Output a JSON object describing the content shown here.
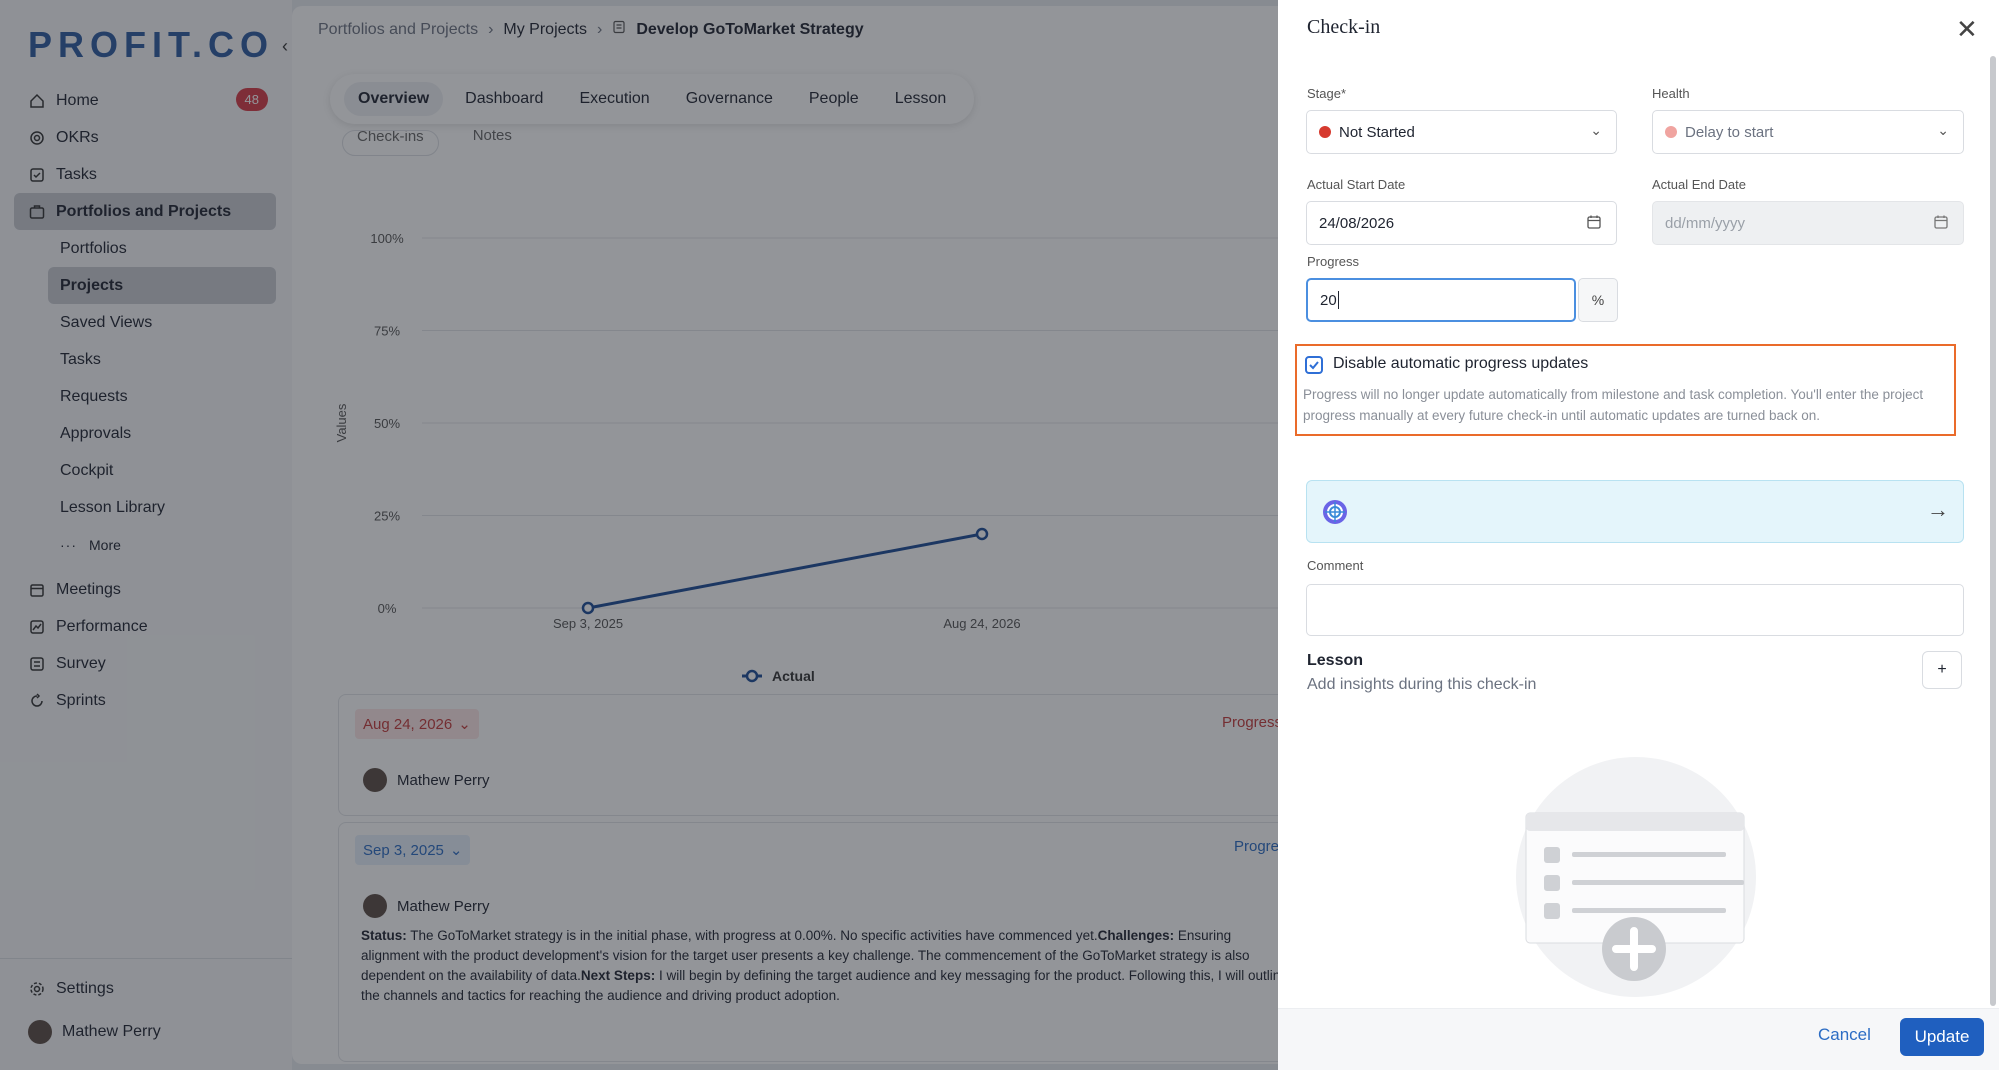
{
  "sidebar": {
    "logo": "PROFIT.CO",
    "collapse_icon": "‹",
    "items": [
      {
        "label": "Home",
        "icon": "home-icon",
        "badge": "48"
      },
      {
        "label": "OKRs",
        "icon": "target-icon"
      },
      {
        "label": "Tasks",
        "icon": "task-icon"
      },
      {
        "label": "Portfolios and Projects",
        "icon": "briefcase-icon",
        "active": true
      }
    ],
    "sub_items": [
      "Portfolios",
      "Projects",
      "Saved Views",
      "Tasks",
      "Requests",
      "Approvals",
      "Cockpit",
      "Lesson Library"
    ],
    "more_label": "More",
    "items2": [
      {
        "label": "Meetings",
        "icon": "calendar-icon"
      },
      {
        "label": "Performance",
        "icon": "performance-icon"
      },
      {
        "label": "Survey",
        "icon": "survey-icon"
      },
      {
        "label": "Sprints",
        "icon": "sprint-icon"
      }
    ],
    "settings_label": "Settings",
    "user_name": "Mathew Perry"
  },
  "main": {
    "breadcrumb": [
      "Portfolios and Projects",
      "My Projects",
      "Develop GoToMarket Strategy"
    ],
    "tabs": [
      "Overview",
      "Dashboard",
      "Execution",
      "Governance",
      "People",
      "Lesson"
    ],
    "subtabs": [
      "Check-ins",
      "Notes"
    ],
    "entries": [
      {
        "date": "Aug 24, 2026",
        "progress_label": "Progress",
        "user": "Mathew Perry"
      },
      {
        "date": "Sep 3, 2025",
        "progress_label": "Progre",
        "user": "Mathew Perry",
        "status_label": "Status:",
        "status_text": " The GoToMarket strategy is in the initial phase, with progress at 0.00%. No specific activities have commenced yet.",
        "challenges_label": "Challenges:",
        "challenges_text": " Ensuring alignment with the product development's vision for the target user presents a key challenge. The commencement of the GoToMarket strategy is also dependent on the availability of data.",
        "next_label": "Next Steps:",
        "next_text": " I will begin by defining the target audience and key messaging for the product. Following this, I will outline the channels and tactics for reaching the audience and driving product adoption."
      }
    ]
  },
  "chart_data": {
    "type": "line",
    "x": [
      "Sep 3, 2025",
      "Aug 24, 2026"
    ],
    "series": [
      {
        "name": "Actual",
        "values": [
          0,
          20
        ]
      }
    ],
    "ylabel": "Values",
    "yticks": [
      "100%",
      "75%",
      "50%",
      "25%",
      "0%"
    ],
    "ylim": [
      0,
      100
    ],
    "legend": "bottom",
    "line_color": "#1c4b96"
  },
  "drawer": {
    "title": "Check-in",
    "stage_label": "Stage*",
    "stage_value": "Not Started",
    "stage_color": "#d63a2f",
    "health_label": "Health",
    "health_value": "Delay to start",
    "health_color": "#f0a4a0",
    "start_label": "Actual Start Date",
    "start_value": "24/08/2026",
    "end_label": "Actual End Date",
    "end_placeholder": "dd/mm/yyyy",
    "progress_label": "Progress",
    "progress_value": "20",
    "progress_unit": "%",
    "disable_checked": true,
    "disable_label": "Disable automatic progress updates",
    "disable_text": "Progress will no longer update automatically from milestone and task completion. You'll enter the project progress manually at every future check-in until automatic updates are turned back on.",
    "comment_label": "Comment",
    "lesson_title": "Lesson",
    "lesson_sub": "Add insights during this check-in",
    "lesson_add": "+",
    "cancel_label": "Cancel",
    "update_label": "Update"
  }
}
